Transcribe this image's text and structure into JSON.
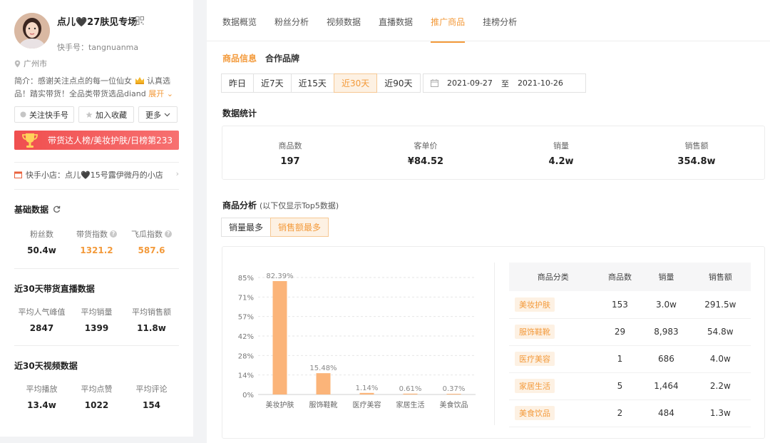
{
  "profile": {
    "name": "点儿🖤27肤见专场",
    "kuaishou_id": "快手号：tangnuanma",
    "location": "广州市",
    "bio_prefix": "简介：感谢关注点点的每一位仙女",
    "bio_suffix": "认真选品！踏实带货！全品类带货选品diand",
    "bio_expand": "展开"
  },
  "actions": {
    "follow": "关注快手号",
    "favorite": "加入收藏",
    "more": "更多"
  },
  "rank_banner": "带货达人榜/美妆护肤/日榜第233",
  "shop": {
    "label": "快手小店：点儿🖤15号露伊微丹的小店",
    "arrow": "›"
  },
  "basic_data": {
    "title": "基础数据",
    "stats": [
      {
        "label": "粉丝数",
        "value": "50.4w"
      },
      {
        "label": "带货指数",
        "value": "1321.2"
      },
      {
        "label": "飞瓜指数",
        "value": "587.6"
      }
    ]
  },
  "live_data": {
    "title": "近30天带货直播数据",
    "stats": [
      {
        "label": "平均人气峰值",
        "value": "2847"
      },
      {
        "label": "平均销量",
        "value": "1399"
      },
      {
        "label": "平均销售额",
        "value": "11.8w"
      }
    ]
  },
  "video_data": {
    "title": "近30天视频数据",
    "stats": [
      {
        "label": "平均播放",
        "value": "13.4w"
      },
      {
        "label": "平均点赞",
        "value": "1022"
      },
      {
        "label": "平均评论",
        "value": "154"
      }
    ]
  },
  "tabs": [
    "数据概览",
    "粉丝分析",
    "视频数据",
    "直播数据",
    "推广商品",
    "挂榜分析"
  ],
  "subtabs": [
    "商品信息",
    "合作品牌"
  ],
  "ranges": [
    "昨日",
    "近7天",
    "近15天",
    "近30天",
    "近90天"
  ],
  "date": {
    "start": "2021-09-27",
    "to": "至",
    "end": "2021-10-26"
  },
  "stats_title": "数据统计",
  "summary": [
    {
      "label": "商品数",
      "value": "197"
    },
    {
      "label": "客单价",
      "value": "¥84.52"
    },
    {
      "label": "销量",
      "value": "4.2w"
    },
    {
      "label": "销售额",
      "value": "354.8w"
    }
  ],
  "analysis": {
    "title": "商品分析",
    "note": "(以下仅显示Top5数据)",
    "sort_options": [
      "销量最多",
      "销售额最多"
    ]
  },
  "chart_data": {
    "type": "bar",
    "categories": [
      "美妆护肤",
      "服饰鞋靴",
      "医疗美容",
      "家居生活",
      "美食饮品"
    ],
    "values": [
      82.39,
      15.48,
      1.14,
      0.61,
      0.37
    ],
    "data_labels": [
      "82.39%",
      "15.48%",
      "1.14%",
      "0.61%",
      "0.37%"
    ],
    "yticks": [
      "0%",
      "14%",
      "28%",
      "42%",
      "57%",
      "71%",
      "85%"
    ],
    "ylim": [
      0,
      85
    ],
    "grid": true,
    "bar_color": "#fbb479"
  },
  "table": {
    "headers": [
      "商品分类",
      "商品数",
      "销量",
      "销售额"
    ],
    "rows": [
      {
        "cat": "美妆护肤",
        "count": "153",
        "sales": "3.0w",
        "revenue": "291.5w"
      },
      {
        "cat": "服饰鞋靴",
        "count": "29",
        "sales": "8,983",
        "revenue": "54.8w"
      },
      {
        "cat": "医疗美容",
        "count": "1",
        "sales": "686",
        "revenue": "4.0w"
      },
      {
        "cat": "家居生活",
        "count": "5",
        "sales": "1,464",
        "revenue": "2.2w"
      },
      {
        "cat": "美食饮品",
        "count": "2",
        "sales": "484",
        "revenue": "1.3w"
      }
    ]
  },
  "colors": {
    "accent": "#f39a3b",
    "banner": "#f04f4f"
  }
}
